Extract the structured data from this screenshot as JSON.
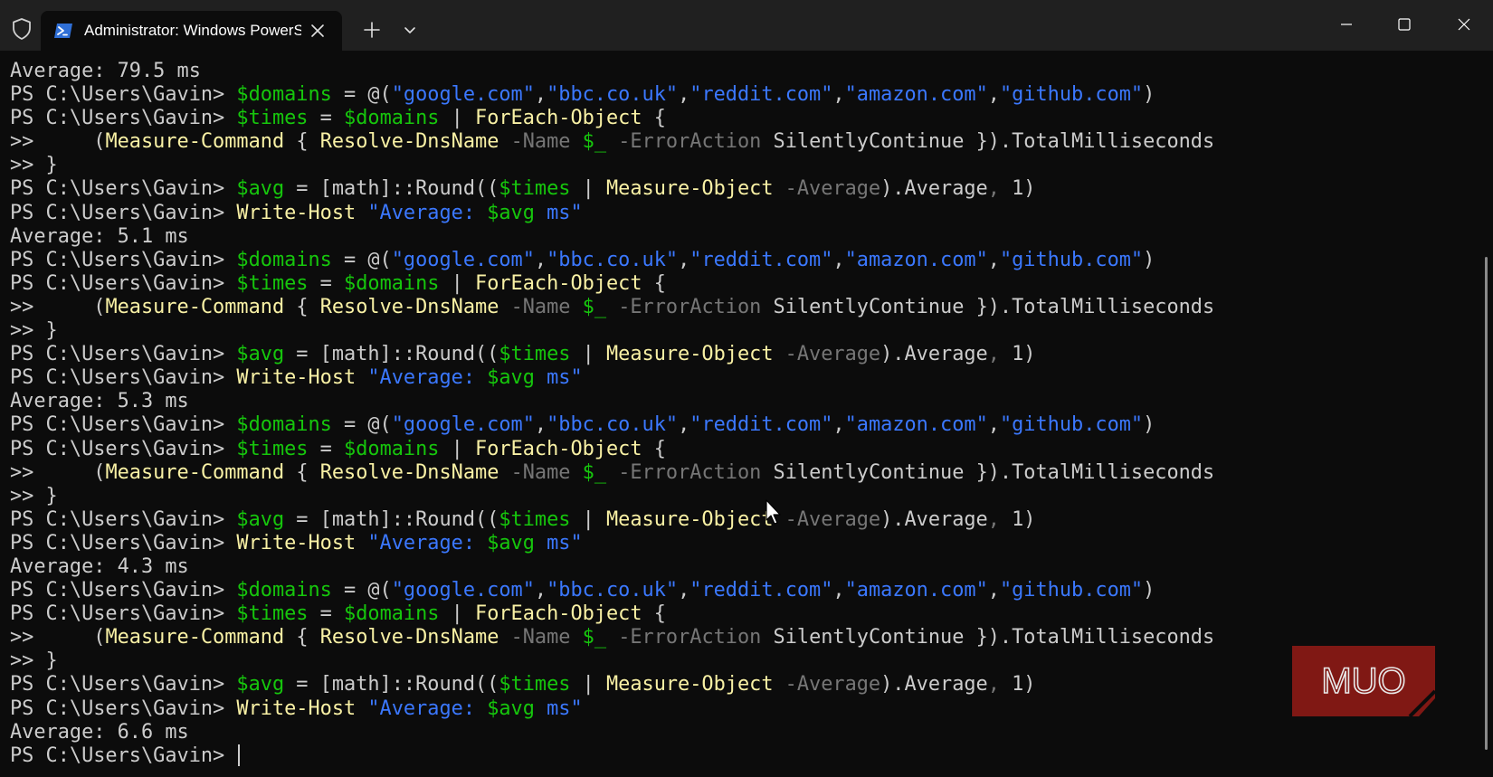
{
  "window": {
    "tab_title": "Administrator: Windows PowerShell",
    "icons": {
      "shield": "shield-icon",
      "tab": "powershell-icon",
      "close_tab": "close-icon",
      "new_tab": "plus-icon",
      "dropdown": "chevron-down-icon",
      "minimize": "minimize-icon",
      "maximize": "maximize-icon",
      "close": "close-icon"
    }
  },
  "colors": {
    "background": "#0c0c0c",
    "titlebar": "#202020",
    "default_text": "#cccccc",
    "variable": "#16c60c",
    "string": "#3b78ff",
    "command": "#f9f1a5",
    "parameter": "#767676",
    "watermark": "#8b1a16"
  },
  "watermark": {
    "text": "MUO"
  },
  "terminal": {
    "lines": [
      [
        {
          "t": "Average: 79.5 ms",
          "c": "default_text"
        }
      ],
      [
        {
          "t": "PS C:\\Users\\Gavin> ",
          "c": "default_text"
        },
        {
          "t": "$domains",
          "c": "variable"
        },
        {
          "t": " = @(",
          "c": "default_text"
        },
        {
          "t": "\"google.com\"",
          "c": "string"
        },
        {
          "t": ",",
          "c": "default_text"
        },
        {
          "t": "\"bbc.co.uk\"",
          "c": "string"
        },
        {
          "t": ",",
          "c": "default_text"
        },
        {
          "t": "\"reddit.com\"",
          "c": "string"
        },
        {
          "t": ",",
          "c": "default_text"
        },
        {
          "t": "\"amazon.com\"",
          "c": "string"
        },
        {
          "t": ",",
          "c": "default_text"
        },
        {
          "t": "\"github.com\"",
          "c": "string"
        },
        {
          "t": ")",
          "c": "default_text"
        }
      ],
      [
        {
          "t": "PS C:\\Users\\Gavin> ",
          "c": "default_text"
        },
        {
          "t": "$times",
          "c": "variable"
        },
        {
          "t": " = ",
          "c": "default_text"
        },
        {
          "t": "$domains",
          "c": "variable"
        },
        {
          "t": " | ",
          "c": "default_text"
        },
        {
          "t": "ForEach-Object",
          "c": "command"
        },
        {
          "t": " {",
          "c": "default_text"
        }
      ],
      [
        {
          "t": ">>     (",
          "c": "default_text"
        },
        {
          "t": "Measure-Command",
          "c": "command"
        },
        {
          "t": " { ",
          "c": "default_text"
        },
        {
          "t": "Resolve-DnsName",
          "c": "command"
        },
        {
          "t": " -Name ",
          "c": "parameter"
        },
        {
          "t": "$_",
          "c": "variable"
        },
        {
          "t": " -ErrorAction ",
          "c": "parameter"
        },
        {
          "t": "SilentlyContinue }).TotalMilliseconds",
          "c": "default_text"
        }
      ],
      [
        {
          "t": ">> }",
          "c": "default_text"
        }
      ],
      [
        {
          "t": "PS C:\\Users\\Gavin> ",
          "c": "default_text"
        },
        {
          "t": "$avg",
          "c": "variable"
        },
        {
          "t": " = [math]::Round((",
          "c": "default_text"
        },
        {
          "t": "$times",
          "c": "variable"
        },
        {
          "t": " | ",
          "c": "default_text"
        },
        {
          "t": "Measure-Object",
          "c": "command"
        },
        {
          "t": " -Average",
          "c": "parameter"
        },
        {
          "t": ").Average",
          "c": "default_text"
        },
        {
          "t": ",",
          "c": "parameter"
        },
        {
          "t": " 1)",
          "c": "default_text"
        }
      ],
      [
        {
          "t": "PS C:\\Users\\Gavin> ",
          "c": "default_text"
        },
        {
          "t": "Write-Host",
          "c": "command"
        },
        {
          "t": " \"Average: ",
          "c": "string"
        },
        {
          "t": "$avg",
          "c": "variable"
        },
        {
          "t": " ms\"",
          "c": "string"
        }
      ],
      [
        {
          "t": "Average: 5.1 ms",
          "c": "default_text"
        }
      ],
      [
        {
          "t": "PS C:\\Users\\Gavin> ",
          "c": "default_text"
        },
        {
          "t": "$domains",
          "c": "variable"
        },
        {
          "t": " = @(",
          "c": "default_text"
        },
        {
          "t": "\"google.com\"",
          "c": "string"
        },
        {
          "t": ",",
          "c": "default_text"
        },
        {
          "t": "\"bbc.co.uk\"",
          "c": "string"
        },
        {
          "t": ",",
          "c": "default_text"
        },
        {
          "t": "\"reddit.com\"",
          "c": "string"
        },
        {
          "t": ",",
          "c": "default_text"
        },
        {
          "t": "\"amazon.com\"",
          "c": "string"
        },
        {
          "t": ",",
          "c": "default_text"
        },
        {
          "t": "\"github.com\"",
          "c": "string"
        },
        {
          "t": ")",
          "c": "default_text"
        }
      ],
      [
        {
          "t": "PS C:\\Users\\Gavin> ",
          "c": "default_text"
        },
        {
          "t": "$times",
          "c": "variable"
        },
        {
          "t": " = ",
          "c": "default_text"
        },
        {
          "t": "$domains",
          "c": "variable"
        },
        {
          "t": " | ",
          "c": "default_text"
        },
        {
          "t": "ForEach-Object",
          "c": "command"
        },
        {
          "t": " {",
          "c": "default_text"
        }
      ],
      [
        {
          "t": ">>     (",
          "c": "default_text"
        },
        {
          "t": "Measure-Command",
          "c": "command"
        },
        {
          "t": " { ",
          "c": "default_text"
        },
        {
          "t": "Resolve-DnsName",
          "c": "command"
        },
        {
          "t": " -Name ",
          "c": "parameter"
        },
        {
          "t": "$_",
          "c": "variable"
        },
        {
          "t": " -ErrorAction ",
          "c": "parameter"
        },
        {
          "t": "SilentlyContinue }).TotalMilliseconds",
          "c": "default_text"
        }
      ],
      [
        {
          "t": ">> }",
          "c": "default_text"
        }
      ],
      [
        {
          "t": "PS C:\\Users\\Gavin> ",
          "c": "default_text"
        },
        {
          "t": "$avg",
          "c": "variable"
        },
        {
          "t": " = [math]::Round((",
          "c": "default_text"
        },
        {
          "t": "$times",
          "c": "variable"
        },
        {
          "t": " | ",
          "c": "default_text"
        },
        {
          "t": "Measure-Object",
          "c": "command"
        },
        {
          "t": " -Average",
          "c": "parameter"
        },
        {
          "t": ").Average",
          "c": "default_text"
        },
        {
          "t": ",",
          "c": "parameter"
        },
        {
          "t": " 1)",
          "c": "default_text"
        }
      ],
      [
        {
          "t": "PS C:\\Users\\Gavin> ",
          "c": "default_text"
        },
        {
          "t": "Write-Host",
          "c": "command"
        },
        {
          "t": " \"Average: ",
          "c": "string"
        },
        {
          "t": "$avg",
          "c": "variable"
        },
        {
          "t": " ms\"",
          "c": "string"
        }
      ],
      [
        {
          "t": "Average: 5.3 ms",
          "c": "default_text"
        }
      ],
      [
        {
          "t": "PS C:\\Users\\Gavin> ",
          "c": "default_text"
        },
        {
          "t": "$domains",
          "c": "variable"
        },
        {
          "t": " = @(",
          "c": "default_text"
        },
        {
          "t": "\"google.com\"",
          "c": "string"
        },
        {
          "t": ",",
          "c": "default_text"
        },
        {
          "t": "\"bbc.co.uk\"",
          "c": "string"
        },
        {
          "t": ",",
          "c": "default_text"
        },
        {
          "t": "\"reddit.com\"",
          "c": "string"
        },
        {
          "t": ",",
          "c": "default_text"
        },
        {
          "t": "\"amazon.com\"",
          "c": "string"
        },
        {
          "t": ",",
          "c": "default_text"
        },
        {
          "t": "\"github.com\"",
          "c": "string"
        },
        {
          "t": ")",
          "c": "default_text"
        }
      ],
      [
        {
          "t": "PS C:\\Users\\Gavin> ",
          "c": "default_text"
        },
        {
          "t": "$times",
          "c": "variable"
        },
        {
          "t": " = ",
          "c": "default_text"
        },
        {
          "t": "$domains",
          "c": "variable"
        },
        {
          "t": " | ",
          "c": "default_text"
        },
        {
          "t": "ForEach-Object",
          "c": "command"
        },
        {
          "t": " {",
          "c": "default_text"
        }
      ],
      [
        {
          "t": ">>     (",
          "c": "default_text"
        },
        {
          "t": "Measure-Command",
          "c": "command"
        },
        {
          "t": " { ",
          "c": "default_text"
        },
        {
          "t": "Resolve-DnsName",
          "c": "command"
        },
        {
          "t": " -Name ",
          "c": "parameter"
        },
        {
          "t": "$_",
          "c": "variable"
        },
        {
          "t": " -ErrorAction ",
          "c": "parameter"
        },
        {
          "t": "SilentlyContinue }).TotalMilliseconds",
          "c": "default_text"
        }
      ],
      [
        {
          "t": ">> }",
          "c": "default_text"
        }
      ],
      [
        {
          "t": "PS C:\\Users\\Gavin> ",
          "c": "default_text"
        },
        {
          "t": "$avg",
          "c": "variable"
        },
        {
          "t": " = [math]::Round((",
          "c": "default_text"
        },
        {
          "t": "$times",
          "c": "variable"
        },
        {
          "t": " | ",
          "c": "default_text"
        },
        {
          "t": "Measure-Object",
          "c": "command"
        },
        {
          "t": " -Average",
          "c": "parameter"
        },
        {
          "t": ").Average",
          "c": "default_text"
        },
        {
          "t": ",",
          "c": "parameter"
        },
        {
          "t": " 1)",
          "c": "default_text"
        }
      ],
      [
        {
          "t": "PS C:\\Users\\Gavin> ",
          "c": "default_text"
        },
        {
          "t": "Write-Host",
          "c": "command"
        },
        {
          "t": " \"Average: ",
          "c": "string"
        },
        {
          "t": "$avg",
          "c": "variable"
        },
        {
          "t": " ms\"",
          "c": "string"
        }
      ],
      [
        {
          "t": "Average: 4.3 ms",
          "c": "default_text"
        }
      ],
      [
        {
          "t": "PS C:\\Users\\Gavin> ",
          "c": "default_text"
        },
        {
          "t": "$domains",
          "c": "variable"
        },
        {
          "t": " = @(",
          "c": "default_text"
        },
        {
          "t": "\"google.com\"",
          "c": "string"
        },
        {
          "t": ",",
          "c": "default_text"
        },
        {
          "t": "\"bbc.co.uk\"",
          "c": "string"
        },
        {
          "t": ",",
          "c": "default_text"
        },
        {
          "t": "\"reddit.com\"",
          "c": "string"
        },
        {
          "t": ",",
          "c": "default_text"
        },
        {
          "t": "\"amazon.com\"",
          "c": "string"
        },
        {
          "t": ",",
          "c": "default_text"
        },
        {
          "t": "\"github.com\"",
          "c": "string"
        },
        {
          "t": ")",
          "c": "default_text"
        }
      ],
      [
        {
          "t": "PS C:\\Users\\Gavin> ",
          "c": "default_text"
        },
        {
          "t": "$times",
          "c": "variable"
        },
        {
          "t": " = ",
          "c": "default_text"
        },
        {
          "t": "$domains",
          "c": "variable"
        },
        {
          "t": " | ",
          "c": "default_text"
        },
        {
          "t": "ForEach-Object",
          "c": "command"
        },
        {
          "t": " {",
          "c": "default_text"
        }
      ],
      [
        {
          "t": ">>     (",
          "c": "default_text"
        },
        {
          "t": "Measure-Command",
          "c": "command"
        },
        {
          "t": " { ",
          "c": "default_text"
        },
        {
          "t": "Resolve-DnsName",
          "c": "command"
        },
        {
          "t": " -Name ",
          "c": "parameter"
        },
        {
          "t": "$_",
          "c": "variable"
        },
        {
          "t": " -ErrorAction ",
          "c": "parameter"
        },
        {
          "t": "SilentlyContinue }).TotalMilliseconds",
          "c": "default_text"
        }
      ],
      [
        {
          "t": ">> }",
          "c": "default_text"
        }
      ],
      [
        {
          "t": "PS C:\\Users\\Gavin> ",
          "c": "default_text"
        },
        {
          "t": "$avg",
          "c": "variable"
        },
        {
          "t": " = [math]::Round((",
          "c": "default_text"
        },
        {
          "t": "$times",
          "c": "variable"
        },
        {
          "t": " | ",
          "c": "default_text"
        },
        {
          "t": "Measure-Object",
          "c": "command"
        },
        {
          "t": " -Average",
          "c": "parameter"
        },
        {
          "t": ").Average",
          "c": "default_text"
        },
        {
          "t": ",",
          "c": "parameter"
        },
        {
          "t": " 1)",
          "c": "default_text"
        }
      ],
      [
        {
          "t": "PS C:\\Users\\Gavin> ",
          "c": "default_text"
        },
        {
          "t": "Write-Host",
          "c": "command"
        },
        {
          "t": " \"Average: ",
          "c": "string"
        },
        {
          "t": "$avg",
          "c": "variable"
        },
        {
          "t": " ms\"",
          "c": "string"
        }
      ],
      [
        {
          "t": "Average: 6.6 ms",
          "c": "default_text"
        }
      ],
      [
        {
          "t": "PS C:\\Users\\Gavin> ",
          "c": "default_text"
        }
      ]
    ]
  }
}
